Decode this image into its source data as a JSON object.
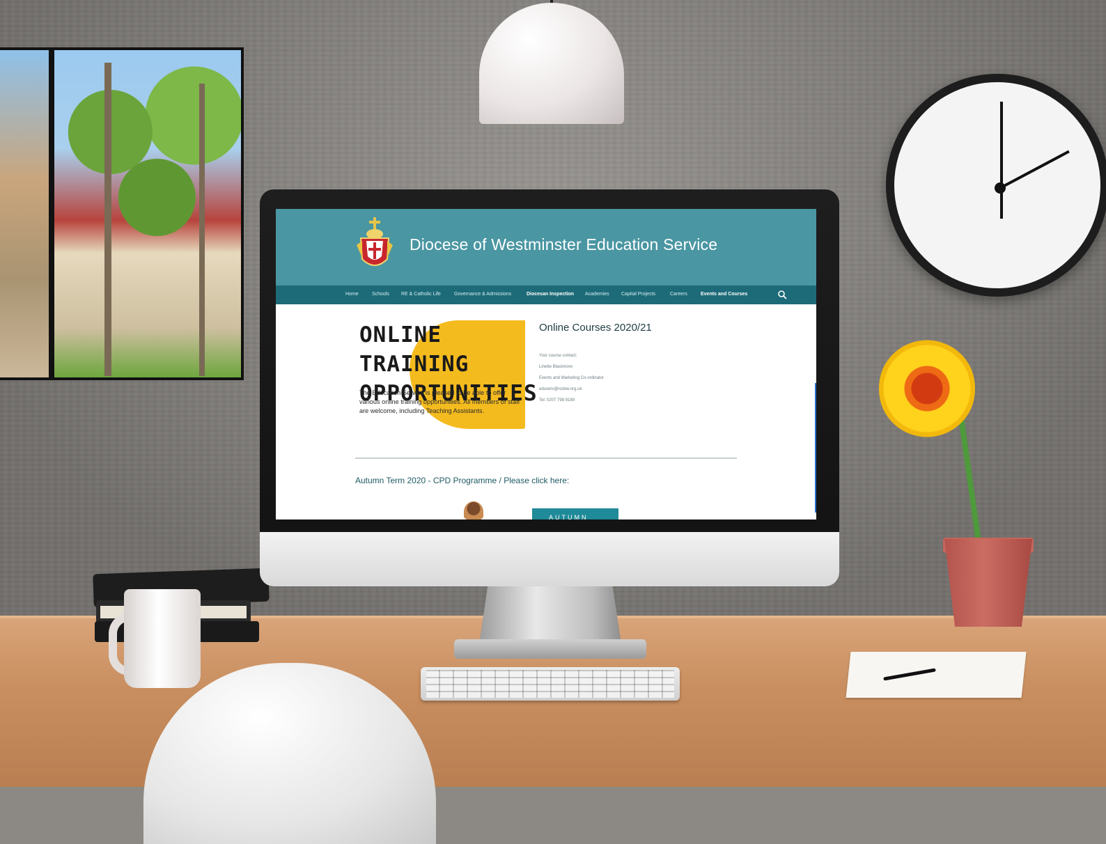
{
  "website": {
    "header": {
      "title": "Diocese of Westminster Education Service"
    },
    "nav": {
      "items": [
        {
          "label": "Home"
        },
        {
          "label": "Schools"
        },
        {
          "label": "RE & Catholic Life"
        },
        {
          "label": "Governance & Admissions"
        },
        {
          "label": "Diocesan Inspection"
        },
        {
          "label": "Academies"
        },
        {
          "label": "Capital Projects"
        },
        {
          "label": "Careers"
        },
        {
          "label": "Events and Courses"
        }
      ],
      "search_icon": "search-icon"
    },
    "promo": {
      "heading": "ONLINE TRAINING OPPORTUNITIES",
      "body": "The Education Service is pleased to be able to offer various online training opportunities. All members of staff are welcome, including Teaching Assistants."
    },
    "courses": {
      "title": "Online Courses 2020/21",
      "contact": [
        "Your course contact:",
        "Linette Blackmore",
        "Events and Marketing Co-ordinator",
        "eduserv@rcdow.org.uk",
        "Tel: 0207 798 9189"
      ]
    },
    "cpd_link": "Autumn Term 2020 - CPD Programme / Please click here:",
    "autumn_thumb_label": "AUTUMN"
  },
  "colors": {
    "header_teal": "#4a96a2",
    "nav_teal": "#1d6b78",
    "promo_yellow": "#f4bb1f",
    "thumb_teal": "#1f8a98"
  }
}
